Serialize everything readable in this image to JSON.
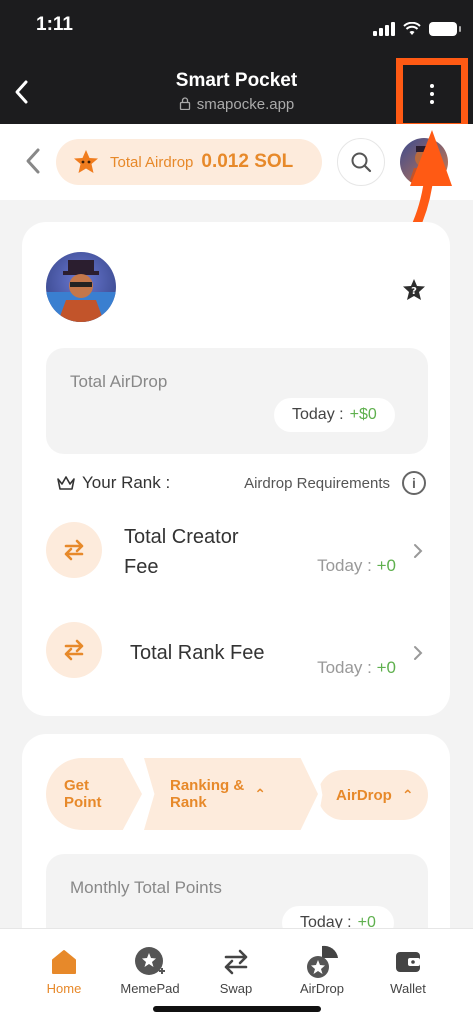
{
  "status_bar": {
    "time": "1:11"
  },
  "browser": {
    "title": "Smart Pocket",
    "url": "smapocke.app"
  },
  "app_header": {
    "total_airdrop_label": "Total Airdrop",
    "total_airdrop_value": "0.012 SOL"
  },
  "summary": {
    "total_airdrop_title": "Total AirDrop",
    "today_label": "Today :",
    "today_value": "+$0",
    "your_rank_label": "Your Rank :",
    "requirements_label": "Airdrop Requirements",
    "fees": [
      {
        "name_line1": "Total Creator",
        "name_line2": "Fee",
        "today_label": "Today :",
        "today_value": "+0"
      },
      {
        "name_line1": "Total Rank Fee",
        "today_label": "Today :",
        "today_value": "+0"
      }
    ]
  },
  "tabs": [
    {
      "line1": "Get",
      "line2": "Point"
    },
    {
      "line1": "Ranking &",
      "line2": "Rank"
    },
    {
      "line1": "AirDrop"
    }
  ],
  "monthly": {
    "title": "Monthly Total Points",
    "today_label": "Today :",
    "today_value": "+0"
  },
  "bottom_nav": [
    {
      "label": "Home",
      "icon": "home-icon",
      "active": true
    },
    {
      "label": "MemePad",
      "icon": "memepad-icon"
    },
    {
      "label": "Swap",
      "icon": "swap-icon"
    },
    {
      "label": "AirDrop",
      "icon": "airdrop-icon"
    },
    {
      "label": "Wallet",
      "icon": "wallet-icon"
    }
  ],
  "colors": {
    "accent": "#e7892a",
    "accent_bg": "#fdebdc",
    "highlight": "#ff5a14",
    "positive": "#5fb04e"
  }
}
